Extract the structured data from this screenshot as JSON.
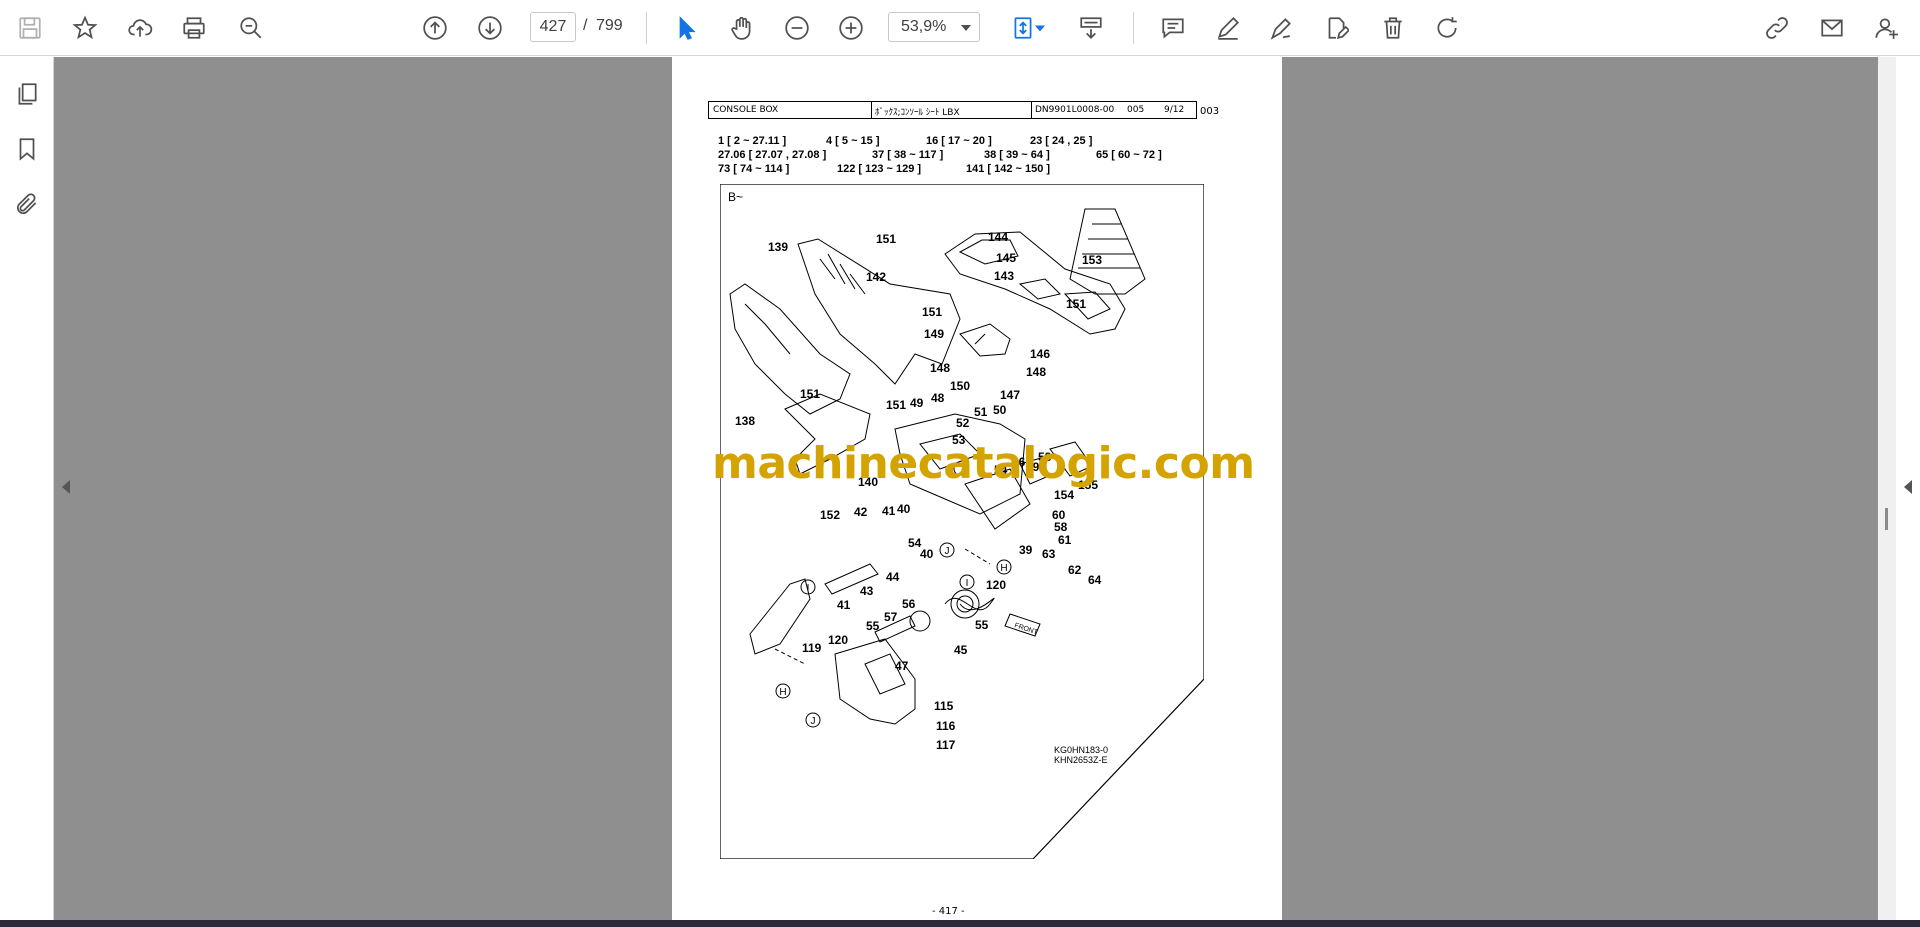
{
  "toolbar": {
    "page_current": "427",
    "page_separator": "/",
    "page_total": "799",
    "zoom": "53,9%"
  },
  "document": {
    "header": {
      "title_en": "CONSOLE BOX",
      "title_jp": "ﾎﾞｯｸｽ;ｺﾝｿｰﾙ ｼｰﾄ LBX",
      "part_code": "DN9901L0008-00",
      "rev": "005",
      "sheet": "9/12",
      "extra": "003"
    },
    "index_lines": [
      [
        "1 [ 2 ~ 27.11 ]",
        "4 [ 5 ~ 15 ]",
        "16 [ 17 ~ 20 ]",
        "23 [ 24 , 25 ]"
      ],
      [
        "27.06 [ 27.07 , 27.08 ]",
        "37 [ 38 ~ 117 ]",
        "38 [ 39 ~ 64 ]",
        "65 [ 60 ~ 72 ]"
      ],
      [
        "73 [ 74 ~ 114 ]",
        "122 [ 123 ~ 129 ]",
        "141 [ 142 ~ 150 ]"
      ]
    ],
    "diagram_corner": "B~",
    "callouts": [
      "151",
      "144",
      "139",
      "145",
      "153",
      "142",
      "143",
      "151",
      "151",
      "149",
      "146",
      "148",
      "148",
      "150",
      "147",
      "151",
      "138",
      "151",
      "49",
      "48",
      "51",
      "50",
      "52",
      "53",
      "140",
      "54",
      "46",
      "58",
      "59",
      "155",
      "154",
      "60",
      "58",
      "61",
      "63",
      "62",
      "64",
      "152",
      "42",
      "41",
      "40",
      "54",
      "40",
      "39",
      "120",
      "43",
      "44",
      "41",
      "120",
      "119",
      "57",
      "56",
      "55",
      "55",
      "45",
      "47",
      "115",
      "116",
      "117"
    ],
    "callout_letters": [
      "J",
      "H",
      "I",
      "I",
      "H",
      "J"
    ],
    "front_label": "FRONT",
    "drawing_codes": [
      "KG0HN183-0",
      "KHN2653Z-E"
    ],
    "page_number": "- 417 -"
  },
  "watermark": "machinecatalogic.com"
}
